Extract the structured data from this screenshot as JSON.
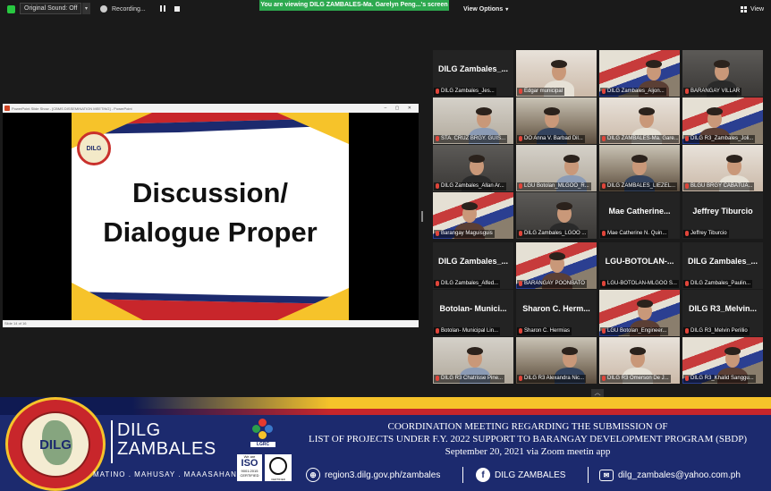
{
  "topbar": {
    "original_sound": "Original Sound: Off",
    "recording": "Recording...",
    "viewing_banner": "You are viewing DILG ZAMBALES-Ma. Garelyn Peng...'s screen",
    "view_options": "View Options",
    "view": "View"
  },
  "share": {
    "window_title": "PowerPoint Slide Show - [CBMS DISSEMINATION MEETING] - PowerPoint",
    "slide_logo_text": "DILG",
    "slide_line1": "Discussion/",
    "slide_line2": "Dialogue Proper",
    "status": "Slide 14 of 16"
  },
  "gallery": [
    {
      "name": "DILG Zambales_...",
      "label": "DILG Zambales_Jes...",
      "type": "name"
    },
    {
      "name": "",
      "label": "Edgar municipal",
      "type": "video"
    },
    {
      "name": "",
      "label": "DILG Zambales_Aljon...",
      "type": "video"
    },
    {
      "name": "",
      "label": "BARANGAY VILLAR",
      "type": "video"
    },
    {
      "name": "",
      "label": "STA. CRUZ BRGY. GUIS...",
      "type": "video"
    },
    {
      "name": "",
      "label": "DO Anna V. Barbad Dil...",
      "type": "video"
    },
    {
      "name": "",
      "label": "DILG ZAMBALES-Ma. Gare...",
      "type": "video"
    },
    {
      "name": "",
      "label": "DILG R3_Zambales_Joli...",
      "type": "video"
    },
    {
      "name": "",
      "label": "DILG Zambales_Allan Ar...",
      "type": "video"
    },
    {
      "name": "",
      "label": "LGU Botolan_MLGOO_R...",
      "type": "video"
    },
    {
      "name": "",
      "label": "DILG ZAMBALES_LIEZEL...",
      "type": "video"
    },
    {
      "name": "",
      "label": "BLGU BRGY CABATUA...",
      "type": "video"
    },
    {
      "name": "",
      "label": "Barangay Maguisguis",
      "type": "video"
    },
    {
      "name": "",
      "label": "DILG Zambales_LGOO ...",
      "type": "video"
    },
    {
      "name": "Mae Catherine...",
      "label": "Mae Catherine N. Quin...",
      "type": "name"
    },
    {
      "name": "Jeffrey Tiburcio",
      "label": "Jeffrey Tiburcio",
      "type": "name"
    },
    {
      "name": "DILG Zambales_...",
      "label": "DILG Zambales_Alfed...",
      "type": "name"
    },
    {
      "name": "",
      "label": "BARANGAY POONBATO",
      "type": "video"
    },
    {
      "name": "LGU-BOTOLAN-...",
      "label": "LGU-BOTOLAN-MLGOO S...",
      "type": "name"
    },
    {
      "name": "DILG Zambales_...",
      "label": "DILG Zambales_Paulin...",
      "type": "name"
    },
    {
      "name": "Botolan- Munici...",
      "label": "Botolan- Municipal Lin...",
      "type": "name"
    },
    {
      "name": "Sharon C. Herm...",
      "label": "Sharon C. Hermias",
      "type": "name"
    },
    {
      "name": "",
      "label": "LGU Botolan_Engineer...",
      "type": "video"
    },
    {
      "name": "DILG R3_Melvin...",
      "label": "DILG R3_Melvin Perillio",
      "type": "name"
    },
    {
      "name": "",
      "label": "DILG R3 Chatrisse Pine...",
      "type": "video"
    },
    {
      "name": "",
      "label": "DILG R3 Alexandra Nic...",
      "type": "video"
    },
    {
      "name": "",
      "label": "DILG R3 Omerson De J...",
      "type": "video"
    },
    {
      "name": "",
      "label": "DILG R3_Khalid Sanggu...",
      "type": "video"
    }
  ],
  "banner": {
    "seal_text": "DILG",
    "org_line1": "DILG",
    "org_line2": "ZAMBALES",
    "motto": "MATINO . MAHUSAY . MAAASAHAN",
    "lgrc": "LGRC",
    "iso_top": "We are",
    "iso_mid": "ISO",
    "iso_bot": "9001:2015 CERTIFIED",
    "circ_text": "CERTIFIED",
    "meeting_line1": "COORDINATION MEETING REGARDING THE SUBMISSION OF",
    "meeting_line2": "LIST OF PROJECTS UNDER F.Y. 2022 SUPPORT TO BARANGAY DEVELOPMENT PROGRAM (SBDP)",
    "meeting_line3": "September 20, 2021 via Zoom meetin app",
    "website": "region3.dilg.gov.ph/zambales",
    "facebook": "DILG ZAMBALES",
    "email": "dilg_zambales@yahoo.com.ph"
  }
}
